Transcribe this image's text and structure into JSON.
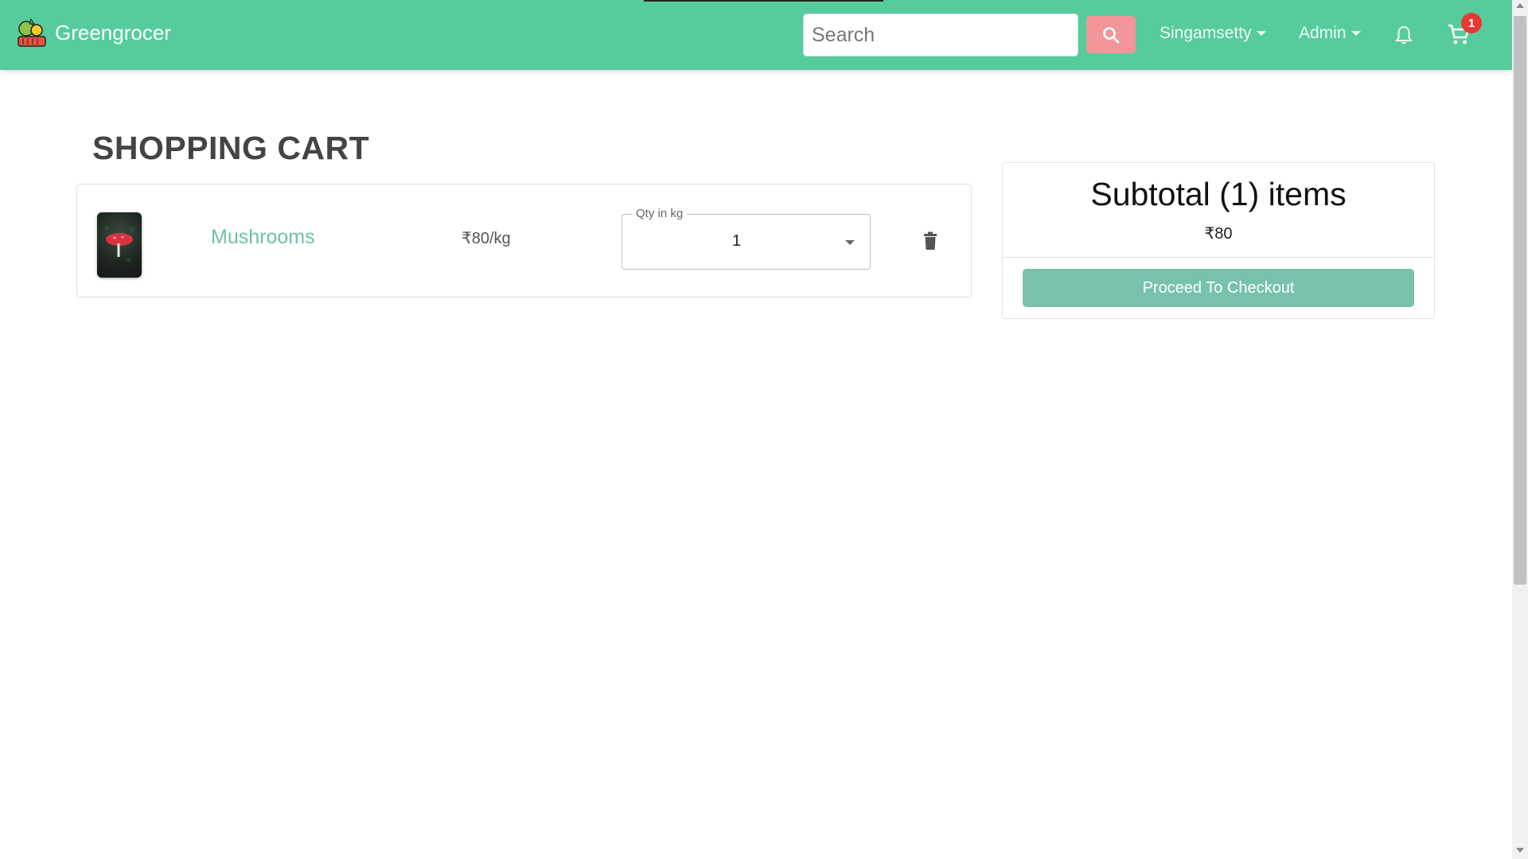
{
  "navbar": {
    "brand": "Greengrocer",
    "search_placeholder": "Search",
    "user_menu": "Singamsetty",
    "admin_menu": "Admin",
    "cart_count": "1"
  },
  "page": {
    "title": "SHOPPING CART"
  },
  "cart": {
    "items": [
      {
        "name": "Mushrooms",
        "price": "₹80/kg",
        "qty_label": "Qty in kg",
        "qty": "1"
      }
    ]
  },
  "summary": {
    "title": "Subtotal (1) items",
    "amount": "₹80",
    "checkout_label": "Proceed To Checkout"
  },
  "colors": {
    "navbar": "#56cc9d",
    "search_button": "#f3969a",
    "checkout_button": "#78c2ad",
    "item_link": "#6fc1a3",
    "badge": "#e53935"
  },
  "icons": [
    "greengrocer-logo",
    "search-icon",
    "bell-icon",
    "cart-icon",
    "trash-icon",
    "chevron-down-icon"
  ]
}
